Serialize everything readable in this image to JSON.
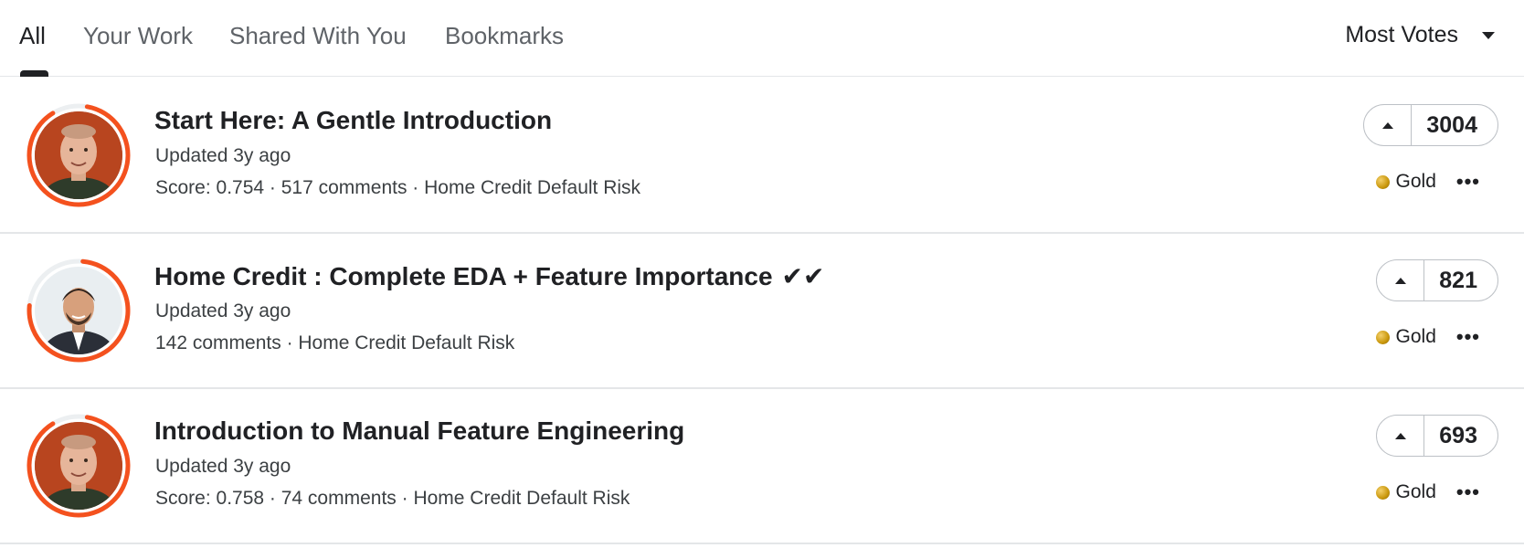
{
  "tabs": [
    {
      "label": "All",
      "active": true
    },
    {
      "label": "Your Work",
      "active": false
    },
    {
      "label": "Shared With You",
      "active": false
    },
    {
      "label": "Bookmarks",
      "active": false
    }
  ],
  "sort": {
    "label": "Most Votes"
  },
  "colors": {
    "accent_ring": "#f4511e",
    "gold_medal": "#d4a017",
    "divider": "#e4e6e8"
  },
  "notebooks": [
    {
      "title": "Start Here: A Gentle Introduction",
      "updated": "Updated 3y ago",
      "meta": "Score: 0.754 · 517 comments · Home Credit Default Risk",
      "votes": "3004",
      "medal": "Gold",
      "avatar": "author-photo"
    },
    {
      "title": "Home Credit : Complete EDA + Feature Importance",
      "title_suffix": "✔✔",
      "updated": "Updated 3y ago",
      "meta": "142 comments · Home Credit Default Risk",
      "votes": "821",
      "medal": "Gold",
      "avatar": "author-photo"
    },
    {
      "title": "Introduction to Manual Feature Engineering",
      "updated": "Updated 3y ago",
      "meta": "Score: 0.758 · 74 comments · Home Credit Default Risk",
      "votes": "693",
      "medal": "Gold",
      "avatar": "author-photo"
    }
  ]
}
